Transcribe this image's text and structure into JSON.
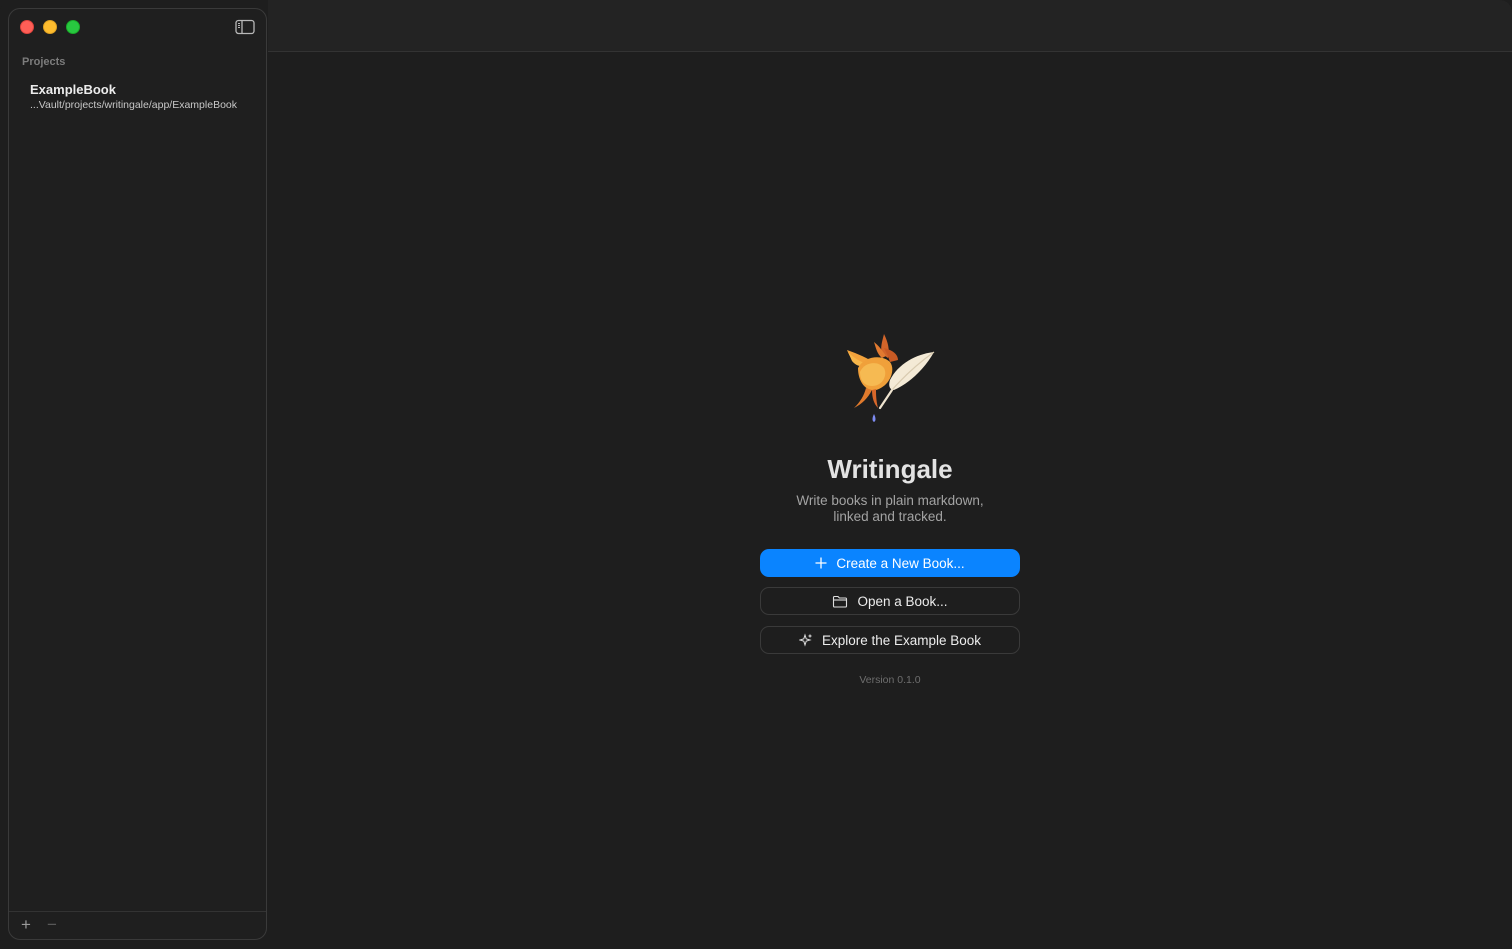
{
  "sidebar": {
    "section_title": "Projects",
    "projects": [
      {
        "name": "ExampleBook",
        "path": "...Vault/projects/writingale/app/ExampleBook"
      }
    ],
    "footer": {
      "add_label": "+",
      "remove_label": "−"
    }
  },
  "welcome": {
    "app_name": "Writingale",
    "tagline_line1": "Write books in plain markdown,",
    "tagline_line2": "linked and tracked.",
    "create_button": "Create a New Book...",
    "open_button": "Open a Book...",
    "explore_button": "Explore the Example Book",
    "version": "Version 0.1.0"
  },
  "icons": {
    "logo": "bird-quill-logo",
    "create": "plus-icon",
    "open": "folder-icon",
    "explore": "sparkles-icon",
    "sidebar_toggle": "sidebar-toggle-icon"
  },
  "colors": {
    "accent": "#0a84ff",
    "window_bg": "#1e1e1e",
    "traffic_close": "#ff5f57",
    "traffic_minimize": "#febc2e",
    "traffic_maximize": "#28c840"
  }
}
